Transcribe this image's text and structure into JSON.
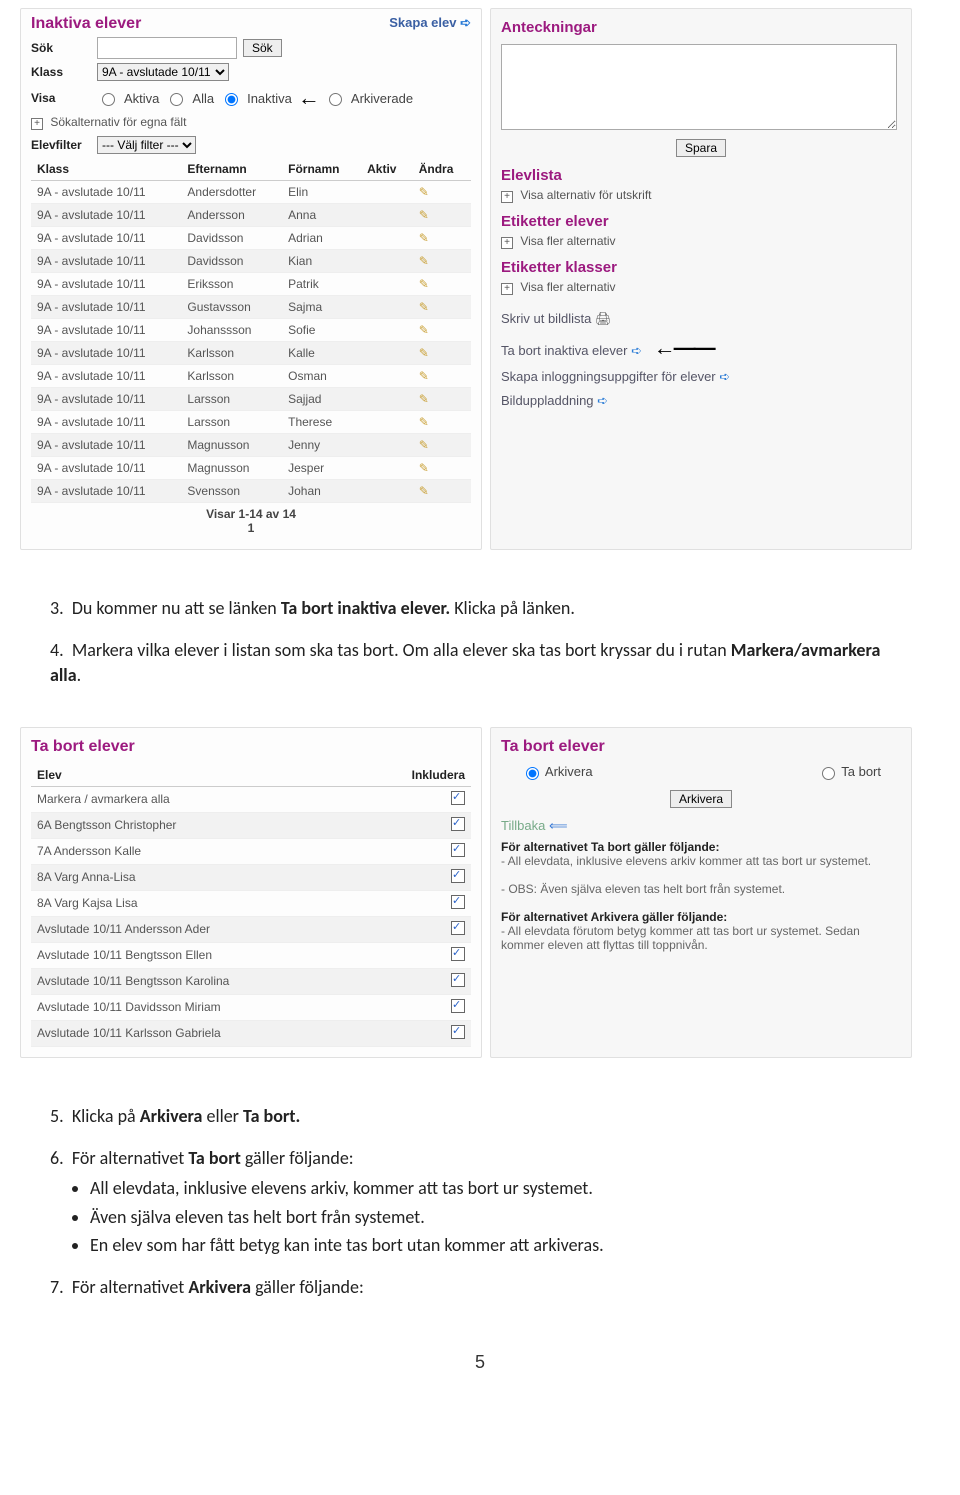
{
  "shot1": {
    "left": {
      "title": "Inaktiva elever",
      "create_link": "Skapa elev",
      "search_label": "Sök",
      "search_btn": "Sök",
      "class_label": "Klass",
      "class_value": "9A - avslutade 10/11",
      "visa_label": "Visa",
      "visa_opts": {
        "aktiva": "Aktiva",
        "alla": "Alla",
        "inaktiva": "Inaktiva",
        "arkiverade": "Arkiverade"
      },
      "own_fields": "Sökalternativ för egna fält",
      "filter_label": "Elevfilter",
      "filter_value": "--- Välj filter ---",
      "cols": {
        "klass": "Klass",
        "efternamn": "Efternamn",
        "fornamn": "Förnamn",
        "aktiv": "Aktiv",
        "andra": "Ändra"
      },
      "rows": [
        {
          "klass": "9A - avslutade 10/11",
          "e": "Andersdotter",
          "f": "Elin"
        },
        {
          "klass": "9A - avslutade 10/11",
          "e": "Andersson",
          "f": "Anna"
        },
        {
          "klass": "9A - avslutade 10/11",
          "e": "Davidsson",
          "f": "Adrian"
        },
        {
          "klass": "9A - avslutade 10/11",
          "e": "Davidsson",
          "f": "Kian"
        },
        {
          "klass": "9A - avslutade 10/11",
          "e": "Eriksson",
          "f": "Patrik"
        },
        {
          "klass": "9A - avslutade 10/11",
          "e": "Gustavsson",
          "f": "Sajma"
        },
        {
          "klass": "9A - avslutade 10/11",
          "e": "Johanssson",
          "f": "Sofie"
        },
        {
          "klass": "9A - avslutade 10/11",
          "e": "Karlsson",
          "f": "Kalle"
        },
        {
          "klass": "9A - avslutade 10/11",
          "e": "Karlsson",
          "f": "Osman"
        },
        {
          "klass": "9A - avslutade 10/11",
          "e": "Larsson",
          "f": "Sajjad"
        },
        {
          "klass": "9A - avslutade 10/11",
          "e": "Larsson",
          "f": "Therese"
        },
        {
          "klass": "9A - avslutade 10/11",
          "e": "Magnusson",
          "f": "Jenny"
        },
        {
          "klass": "9A - avslutade 10/11",
          "e": "Magnusson",
          "f": "Jesper"
        },
        {
          "klass": "9A - avslutade 10/11",
          "e": "Svensson",
          "f": "Johan"
        }
      ],
      "pager": "Visar 1-14 av 14",
      "page": "1"
    },
    "right": {
      "notes_title": "Anteckningar",
      "save_btn": "Spara",
      "elevlist_title": "Elevlista",
      "elevlist_opt": "Visa alternativ för utskrift",
      "etik_elever_title": "Etiketter elever",
      "etik_elever_opt": "Visa fler alternativ",
      "etik_klass_title": "Etiketter klasser",
      "etik_klass_opt": "Visa fler alternativ",
      "links": {
        "bildlista": "Skriv ut bildlista",
        "remove": "Ta bort inaktiva elever",
        "logins": "Skapa inloggningsuppgifter för elever",
        "upload": "Bilduppladdning"
      }
    }
  },
  "doc1": {
    "p3a": "Du kommer nu att se länken ",
    "p3b": "Ta bort inaktiva elever.",
    "p3c": " Klicka på länken.",
    "p4a": "Markera vilka elever i listan som ska tas bort. Om alla elever ska tas bort kryssar du i rutan ",
    "p4b": "Markera/avmarkera alla",
    "p4c": "."
  },
  "shot2": {
    "left": {
      "title": "Ta bort elever",
      "col_elev": "Elev",
      "col_ink": "Inkludera",
      "mark_all": "Markera / avmarkera alla",
      "rows": [
        "6A Bengtsson Christopher",
        "7A Andersson Kalle",
        "8A Varg Anna-Lisa",
        "8A Varg Kajsa Lisa",
        "Avslutade 10/11 Andersson Ader",
        "Avslutade 10/11 Bengtsson Ellen",
        "Avslutade 10/11 Bengtsson Karolina",
        "Avslutade 10/11 Davidsson Miriam",
        "Avslutade 10/11 Karlsson Gabriela"
      ]
    },
    "right": {
      "title": "Ta bort elever",
      "opt_ark": "Arkivera",
      "opt_rm": "Ta bort",
      "btn": "Arkivera",
      "back": "Tillbaka",
      "rm_head": "För alternativet Ta bort gäller följande:",
      "rm_b1": "- All elevdata, inklusive elevens arkiv kommer att tas bort ur systemet.",
      "rm_b2": "- OBS: Även själva eleven tas helt bort från systemet.",
      "ark_head": "För alternativet Arkivera gäller följande:",
      "ark_b1": "- All elevdata förutom betyg kommer att tas bort ur systemet. Sedan kommer eleven att flyttas till toppnivån."
    }
  },
  "doc2": {
    "p5a": "Klicka på ",
    "p5b": "Arkivera",
    "p5c": " eller ",
    "p5d": "Ta bort.",
    "p6a": "För alternativet ",
    "p6b": "Ta bort",
    "p6c": " gäller följande:",
    "p6_li1": "All elevdata, inklusive elevens arkiv, kommer att tas bort ur systemet.",
    "p6_li2": "Även själva eleven tas helt bort från systemet.",
    "p6_li3": "En elev som har fått betyg kan inte tas bort utan kommer att arkiveras.",
    "p7a": "För alternativet ",
    "p7b": "Arkivera",
    "p7c": " gäller följande:"
  },
  "pagenum": "5"
}
